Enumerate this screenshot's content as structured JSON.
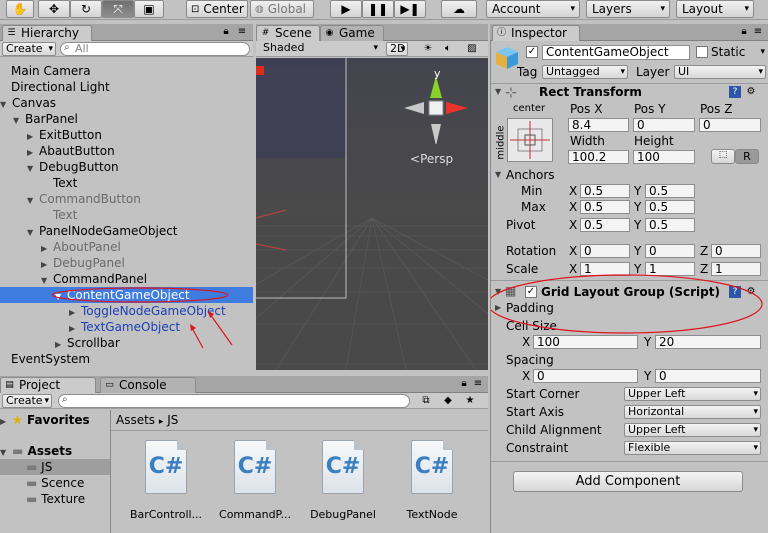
{
  "toolbar": {
    "pivot_label": "Center",
    "space_label": "Global",
    "account_label": "Account",
    "layers_label": "Layers",
    "layout_label": "Layout"
  },
  "hierarchy": {
    "tab_label": "Hierarchy",
    "create_label": "Create",
    "search_placeholder": "All",
    "items": [
      {
        "label": "Main Camera"
      },
      {
        "label": "Directional Light"
      },
      {
        "label": "Canvas"
      },
      {
        "label": "BarPanel"
      },
      {
        "label": "ExitButton"
      },
      {
        "label": "AbautButton"
      },
      {
        "label": "DebugButton"
      },
      {
        "label": "Text"
      },
      {
        "label": "CommandButton"
      },
      {
        "label": "Text"
      },
      {
        "label": "PanelNodeGameObject"
      },
      {
        "label": "AboutPanel"
      },
      {
        "label": "DebugPanel"
      },
      {
        "label": "CommandPanel"
      },
      {
        "label": "ContentGameObject"
      },
      {
        "label": "ToggleNodeGameObject"
      },
      {
        "label": "TextGameObject"
      },
      {
        "label": "Scrollbar"
      },
      {
        "label": "EventSystem"
      }
    ]
  },
  "scene": {
    "tab_label": "Scene",
    "game_tab_label": "Game",
    "shading_label": "Shaded",
    "mode_2d_label": "2D",
    "persp_label": "Persp",
    "gizmo_y_label": "y"
  },
  "project": {
    "tab_label": "Project",
    "console_tab_label": "Console",
    "create_label": "Create",
    "favorites_label": "Favorites",
    "assets_label": "Assets",
    "folders": [
      "JS",
      "Scence",
      "Texture"
    ],
    "breadcrumb_root": "Assets",
    "breadcrumb_sep": "▸",
    "breadcrumb_current": "JS",
    "files": [
      "BarControll...",
      "CommandP...",
      "DebugPanel",
      "TextNode"
    ],
    "file_glyph": "C#"
  },
  "inspector": {
    "tab_label": "Inspector",
    "object_name": "ContentGameObject",
    "static_label": "Static",
    "tag_label": "Tag",
    "tag_value": "Untagged",
    "layer_label": "Layer",
    "layer_value": "UI",
    "rect_transform": {
      "title": "Rect Transform",
      "anchor_h": "center",
      "anchor_v": "middle",
      "posx_label": "Pos X",
      "posx": "8.4",
      "posy_label": "Pos Y",
      "posy": "0",
      "posz_label": "Pos Z",
      "posz": "0",
      "width_label": "Width",
      "width": "100.2",
      "height_label": "Height",
      "height": "100",
      "raw_btn": "R",
      "anchors_label": "Anchors",
      "min_label": "Min",
      "min_x": "0.5",
      "min_y": "0.5",
      "max_label": "Max",
      "max_x": "0.5",
      "max_y": "0.5",
      "pivot_label": "Pivot",
      "pivot_x": "0.5",
      "pivot_y": "0.5",
      "rotation_label": "Rotation",
      "rot_x": "0",
      "rot_y": "0",
      "rot_z": "0",
      "scale_label": "Scale",
      "scale_x": "1",
      "scale_y": "1",
      "scale_z": "1",
      "x": "X",
      "y": "Y",
      "z": "Z"
    },
    "grid_layout": {
      "title": "Grid Layout Group (Script)",
      "padding_label": "Padding",
      "cell_size_label": "Cell Size",
      "cell_x": "100",
      "cell_y": "20",
      "spacing_label": "Spacing",
      "spacing_x": "0",
      "spacing_y": "0",
      "start_corner_label": "Start Corner",
      "start_corner": "Upper Left",
      "start_axis_label": "Start Axis",
      "start_axis": "Horizontal",
      "child_alignment_label": "Child Alignment",
      "child_alignment": "Upper Left",
      "constraint_label": "Constraint",
      "constraint": "Flexible"
    },
    "add_component_label": "Add Component"
  },
  "colors": {
    "selection": "#3e7ce0",
    "annotation_red": "#e0141e",
    "scene_bg": "#474747"
  }
}
